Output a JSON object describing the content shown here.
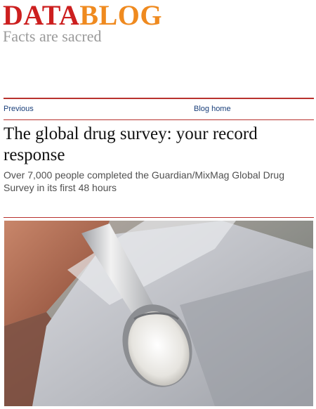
{
  "masthead": {
    "logo_part1": "DATA",
    "logo_part2": "BLOG",
    "tagline": "Facts are sacred"
  },
  "nav": {
    "previous": "Previous",
    "blog_home": "Blog home"
  },
  "article": {
    "headline": "The global drug survey: your record response",
    "standfirst": "Over 7,000 people completed the Guardian/MixMag Global Drug Survey in its first 48 hours"
  },
  "colors": {
    "data_red": "#cc1f1f",
    "blog_orange": "#ef8a1f",
    "rule_red": "#b8322e",
    "link_blue": "#1a3f7a"
  }
}
